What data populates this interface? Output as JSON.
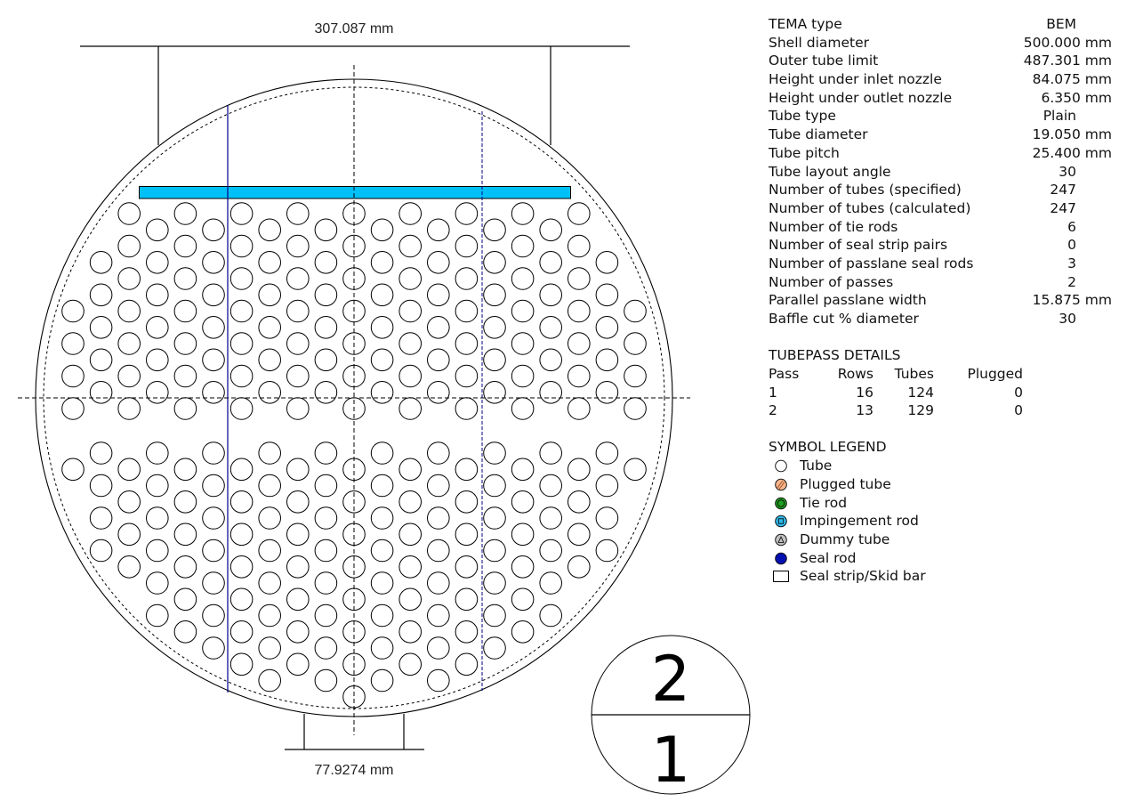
{
  "drawing": {
    "top_dimension": "307.087 mm",
    "bottom_dimension": "77.9274 mm",
    "pass_diagram": {
      "top_pass": "2",
      "bottom_pass": "1"
    },
    "colors": {
      "impingement_plate": "#00C0F8",
      "passlane_line": "#00008B",
      "outline": "#000000"
    },
    "tube_rows_pass2": [
      {
        "cols": [
          2,
          4,
          6,
          8,
          10,
          12,
          14,
          16,
          18
        ]
      },
      {
        "cols": [
          3,
          5,
          7,
          9,
          11,
          13,
          15,
          17
        ]
      },
      {
        "cols": [
          2,
          4,
          6,
          8,
          10,
          12,
          14,
          16,
          18
        ]
      },
      {
        "cols": [
          1,
          3,
          5,
          7,
          9,
          11,
          13,
          15,
          17,
          19
        ]
      },
      {
        "cols": [
          2,
          4,
          6,
          8,
          10,
          12,
          14,
          16,
          18
        ]
      },
      {
        "cols": [
          1,
          3,
          5,
          7,
          9,
          11,
          13,
          15,
          17,
          19
        ]
      },
      {
        "cols": [
          0,
          2,
          4,
          6,
          8,
          10,
          12,
          14,
          16,
          18,
          20
        ]
      },
      {
        "cols": [
          1,
          3,
          5,
          7,
          9,
          11,
          13,
          15,
          17,
          19
        ]
      },
      {
        "cols": [
          0,
          2,
          4,
          6,
          8,
          10,
          12,
          14,
          16,
          18,
          20
        ]
      },
      {
        "cols": [
          1,
          3,
          5,
          7,
          9,
          11,
          13,
          15,
          17,
          19
        ]
      },
      {
        "cols": [
          0,
          2,
          4,
          6,
          8,
          10,
          12,
          14,
          16,
          18,
          20
        ]
      },
      {
        "cols": [
          1,
          3,
          5,
          7,
          9,
          11,
          13,
          15,
          17,
          19
        ]
      },
      {
        "cols": [
          0,
          2,
          4,
          6,
          8,
          10,
          12,
          14,
          16,
          18,
          20
        ]
      }
    ],
    "tube_rows_pass1": [
      {
        "cols": [
          1,
          3,
          5,
          7,
          9,
          11,
          13,
          15,
          17,
          19
        ]
      },
      {
        "cols": [
          0,
          2,
          4,
          6,
          8,
          10,
          12,
          14,
          16,
          18,
          20
        ]
      },
      {
        "cols": [
          1,
          3,
          5,
          7,
          9,
          11,
          13,
          15,
          17,
          19
        ]
      },
      {
        "cols": [
          2,
          4,
          6,
          8,
          10,
          12,
          14,
          16,
          18
        ]
      },
      {
        "cols": [
          1,
          3,
          5,
          7,
          9,
          11,
          13,
          15,
          17,
          19
        ]
      },
      {
        "cols": [
          2,
          4,
          6,
          8,
          10,
          12,
          14,
          16,
          18
        ]
      },
      {
        "cols": [
          1,
          3,
          5,
          7,
          9,
          11,
          13,
          15,
          17,
          19
        ]
      },
      {
        "cols": [
          2,
          4,
          6,
          8,
          10,
          12,
          14,
          16,
          18
        ]
      },
      {
        "cols": [
          3,
          5,
          7,
          9,
          11,
          13,
          15,
          17
        ]
      },
      {
        "cols": [
          4,
          6,
          8,
          10,
          12,
          14,
          16
        ]
      },
      {
        "cols": [
          3,
          5,
          7,
          9,
          11,
          13,
          15,
          17
        ]
      },
      {
        "cols": [
          4,
          6,
          8,
          10,
          12,
          14,
          16
        ]
      },
      {
        "cols": [
          5,
          7,
          9,
          11,
          13,
          15
        ]
      },
      {
        "cols": [
          6,
          8,
          10,
          12,
          14
        ]
      },
      {
        "cols": [
          7,
          9,
          11,
          13
        ]
      },
      {
        "cols": [
          10
        ]
      }
    ]
  },
  "properties": [
    {
      "label": "TEMA type",
      "value": "BEM",
      "unit": false
    },
    {
      "label": "Shell diameter",
      "value": "500.000 mm",
      "unit": true
    },
    {
      "label": "Outer tube limit",
      "value": "487.301 mm",
      "unit": true
    },
    {
      "label": "Height under inlet nozzle",
      "value": "84.075 mm",
      "unit": true
    },
    {
      "label": "Height under outlet nozzle",
      "value": "6.350 mm",
      "unit": true
    },
    {
      "label": "Tube type",
      "value": "Plain",
      "unit": false
    },
    {
      "label": "Tube diameter",
      "value": "19.050 mm",
      "unit": true
    },
    {
      "label": "Tube pitch",
      "value": "25.400 mm",
      "unit": true
    },
    {
      "label": "Tube layout angle",
      "value": "30",
      "unit": false
    },
    {
      "label": "Number of tubes (specified)",
      "value": "247",
      "unit": false
    },
    {
      "label": "Number of tubes (calculated)",
      "value": "247",
      "unit": false
    },
    {
      "label": "Number of tie rods",
      "value": "6",
      "unit": false
    },
    {
      "label": "Number of seal strip pairs",
      "value": "0",
      "unit": false
    },
    {
      "label": "Number of passlane seal rods",
      "value": "3",
      "unit": false
    },
    {
      "label": "Number of passes",
      "value": "2",
      "unit": false
    },
    {
      "label": "Parallel passlane width",
      "value": "15.875 mm",
      "unit": true
    },
    {
      "label": "Baffle cut % diameter",
      "value": "30",
      "unit": false
    }
  ],
  "tubepass": {
    "title": "TUBEPASS DETAILS",
    "headers": [
      "Pass",
      "Rows",
      "Tubes",
      "Plugged"
    ],
    "rows": [
      [
        "1",
        "16",
        "124",
        "0"
      ],
      [
        "2",
        "13",
        "129",
        "0"
      ]
    ]
  },
  "legend": {
    "title": "SYMBOL LEGEND",
    "items": [
      {
        "label": "Tube",
        "icon": "tube-icon",
        "color": "#ffffff"
      },
      {
        "label": "Plugged tube",
        "icon": "plugged-tube-icon",
        "color": "#F4B48C"
      },
      {
        "label": "Tie rod",
        "icon": "tie-rod-icon",
        "color": "#20A020"
      },
      {
        "label": "Impingement rod",
        "icon": "impingement-rod-icon",
        "color": "#30B8E8"
      },
      {
        "label": "Dummy tube",
        "icon": "dummy-tube-icon",
        "color": "#C0C0C0"
      },
      {
        "label": "Seal rod",
        "icon": "seal-rod-icon",
        "color": "#0010B0"
      },
      {
        "label": "Seal strip/Skid bar",
        "icon": "seal-strip-icon",
        "color": "#ffffff"
      }
    ]
  }
}
